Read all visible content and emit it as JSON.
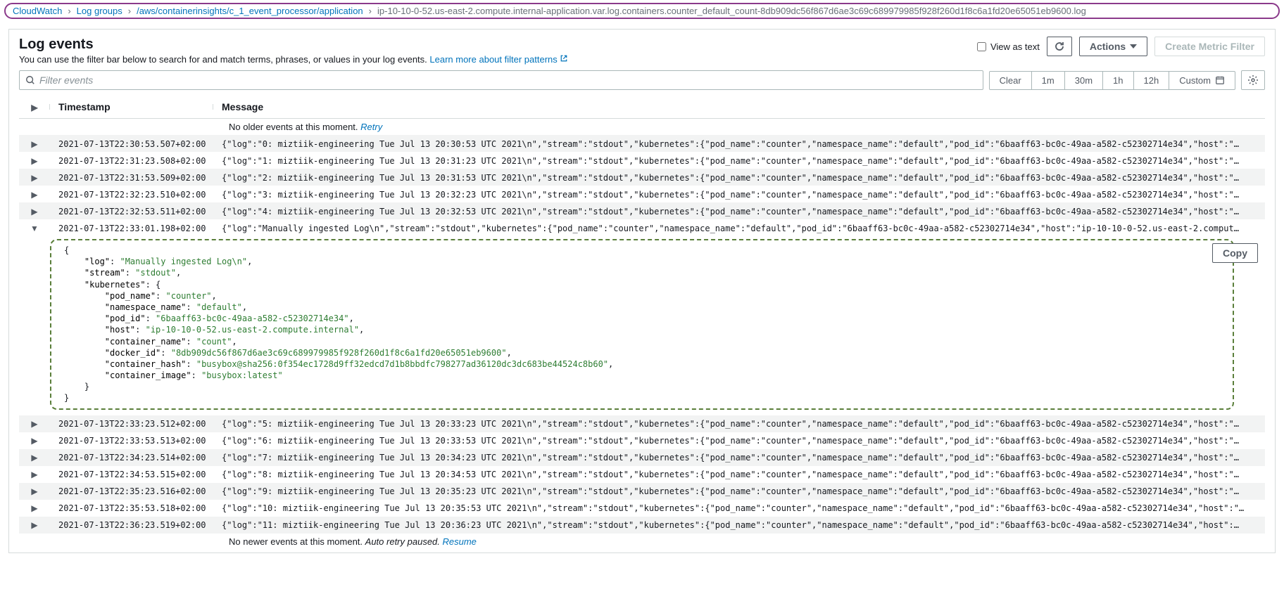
{
  "breadcrumb": {
    "root": "CloudWatch",
    "loggroups": "Log groups",
    "group": "/aws/containerinsights/c_1_event_processor/application",
    "stream": "ip-10-10-0-52.us-east-2.compute.internal-application.var.log.containers.counter_default_count-8db909dc56f867d6ae3c69c689979985f928f260d1f8c6a1fd20e65051eb9600.log"
  },
  "header": {
    "title": "Log events",
    "subtitle_text": "You can use the filter bar below to search for and match terms, phrases, or values in your log events. ",
    "subtitle_link": "Learn more about filter patterns",
    "view_as_text": "View as text",
    "actions": "Actions",
    "create_metric_filter": "Create Metric Filter"
  },
  "filter": {
    "placeholder": "Filter events",
    "clear": "Clear",
    "t1m": "1m",
    "t30m": "30m",
    "t1h": "1h",
    "t12h": "12h",
    "custom": "Custom"
  },
  "table": {
    "col_ts": "Timestamp",
    "col_msg": "Message",
    "no_older": "No older events at this moment. ",
    "retry": "Retry",
    "no_newer": "No newer events at this moment. ",
    "auto_retry": "Auto retry paused. ",
    "resume": "Resume",
    "copy": "Copy"
  },
  "events": [
    {
      "ts": "2021-07-13T22:30:53.507+02:00",
      "msg": "{\"log\":\"0: miztiik-engineering Tue Jul 13 20:30:53 UTC 2021\\n\",\"stream\":\"stdout\",\"kubernetes\":{\"pod_name\":\"counter\",\"namespace_name\":\"default\",\"pod_id\":\"6baaff63-bc0c-49aa-a582-c52302714e34\",\"host\":\"…"
    },
    {
      "ts": "2021-07-13T22:31:23.508+02:00",
      "msg": "{\"log\":\"1: miztiik-engineering Tue Jul 13 20:31:23 UTC 2021\\n\",\"stream\":\"stdout\",\"kubernetes\":{\"pod_name\":\"counter\",\"namespace_name\":\"default\",\"pod_id\":\"6baaff63-bc0c-49aa-a582-c52302714e34\",\"host\":\"…"
    },
    {
      "ts": "2021-07-13T22:31:53.509+02:00",
      "msg": "{\"log\":\"2: miztiik-engineering Tue Jul 13 20:31:53 UTC 2021\\n\",\"stream\":\"stdout\",\"kubernetes\":{\"pod_name\":\"counter\",\"namespace_name\":\"default\",\"pod_id\":\"6baaff63-bc0c-49aa-a582-c52302714e34\",\"host\":\"…"
    },
    {
      "ts": "2021-07-13T22:32:23.510+02:00",
      "msg": "{\"log\":\"3: miztiik-engineering Tue Jul 13 20:32:23 UTC 2021\\n\",\"stream\":\"stdout\",\"kubernetes\":{\"pod_name\":\"counter\",\"namespace_name\":\"default\",\"pod_id\":\"6baaff63-bc0c-49aa-a582-c52302714e34\",\"host\":\"…"
    },
    {
      "ts": "2021-07-13T22:32:53.511+02:00",
      "msg": "{\"log\":\"4: miztiik-engineering Tue Jul 13 20:32:53 UTC 2021\\n\",\"stream\":\"stdout\",\"kubernetes\":{\"pod_name\":\"counter\",\"namespace_name\":\"default\",\"pod_id\":\"6baaff63-bc0c-49aa-a582-c52302714e34\",\"host\":\"…"
    },
    {
      "ts": "2021-07-13T22:33:01.198+02:00",
      "msg": "{\"log\":\"Manually ingested Log\\n\",\"stream\":\"stdout\",\"kubernetes\":{\"pod_name\":\"counter\",\"namespace_name\":\"default\",\"pod_id\":\"6baaff63-bc0c-49aa-a582-c52302714e34\",\"host\":\"ip-10-10-0-52.us-east-2.comput…",
      "expanded": true
    },
    {
      "ts": "2021-07-13T22:33:23.512+02:00",
      "msg": "{\"log\":\"5: miztiik-engineering Tue Jul 13 20:33:23 UTC 2021\\n\",\"stream\":\"stdout\",\"kubernetes\":{\"pod_name\":\"counter\",\"namespace_name\":\"default\",\"pod_id\":\"6baaff63-bc0c-49aa-a582-c52302714e34\",\"host\":\"…"
    },
    {
      "ts": "2021-07-13T22:33:53.513+02:00",
      "msg": "{\"log\":\"6: miztiik-engineering Tue Jul 13 20:33:53 UTC 2021\\n\",\"stream\":\"stdout\",\"kubernetes\":{\"pod_name\":\"counter\",\"namespace_name\":\"default\",\"pod_id\":\"6baaff63-bc0c-49aa-a582-c52302714e34\",\"host\":\"…"
    },
    {
      "ts": "2021-07-13T22:34:23.514+02:00",
      "msg": "{\"log\":\"7: miztiik-engineering Tue Jul 13 20:34:23 UTC 2021\\n\",\"stream\":\"stdout\",\"kubernetes\":{\"pod_name\":\"counter\",\"namespace_name\":\"default\",\"pod_id\":\"6baaff63-bc0c-49aa-a582-c52302714e34\",\"host\":\"…"
    },
    {
      "ts": "2021-07-13T22:34:53.515+02:00",
      "msg": "{\"log\":\"8: miztiik-engineering Tue Jul 13 20:34:53 UTC 2021\\n\",\"stream\":\"stdout\",\"kubernetes\":{\"pod_name\":\"counter\",\"namespace_name\":\"default\",\"pod_id\":\"6baaff63-bc0c-49aa-a582-c52302714e34\",\"host\":\"…"
    },
    {
      "ts": "2021-07-13T22:35:23.516+02:00",
      "msg": "{\"log\":\"9: miztiik-engineering Tue Jul 13 20:35:23 UTC 2021\\n\",\"stream\":\"stdout\",\"kubernetes\":{\"pod_name\":\"counter\",\"namespace_name\":\"default\",\"pod_id\":\"6baaff63-bc0c-49aa-a582-c52302714e34\",\"host\":\"…"
    },
    {
      "ts": "2021-07-13T22:35:53.518+02:00",
      "msg": "{\"log\":\"10: miztiik-engineering Tue Jul 13 20:35:53 UTC 2021\\n\",\"stream\":\"stdout\",\"kubernetes\":{\"pod_name\":\"counter\",\"namespace_name\":\"default\",\"pod_id\":\"6baaff63-bc0c-49aa-a582-c52302714e34\",\"host\":\"…"
    },
    {
      "ts": "2021-07-13T22:36:23.519+02:00",
      "msg": "{\"log\":\"11: miztiik-engineering Tue Jul 13 20:36:23 UTC 2021\\n\",\"stream\":\"stdout\",\"kubernetes\":{\"pod_name\":\"counter\",\"namespace_name\":\"default\",\"pod_id\":\"6baaff63-bc0c-49aa-a582-c52302714e34\",\"host\":…"
    }
  ],
  "expanded_json": {
    "log": "Manually ingested Log\\n",
    "stream": "stdout",
    "kubernetes": {
      "pod_name": "counter",
      "namespace_name": "default",
      "pod_id": "6baaff63-bc0c-49aa-a582-c52302714e34",
      "host": "ip-10-10-0-52.us-east-2.compute.internal",
      "container_name": "count",
      "docker_id": "8db909dc56f867d6ae3c69c689979985f928f260d1f8c6a1fd20e65051eb9600",
      "container_hash": "busybox@sha256:0f354ec1728d9ff32edcd7d1b8bbdfc798277ad36120dc3dc683be44524c8b60",
      "container_image": "busybox:latest"
    }
  }
}
